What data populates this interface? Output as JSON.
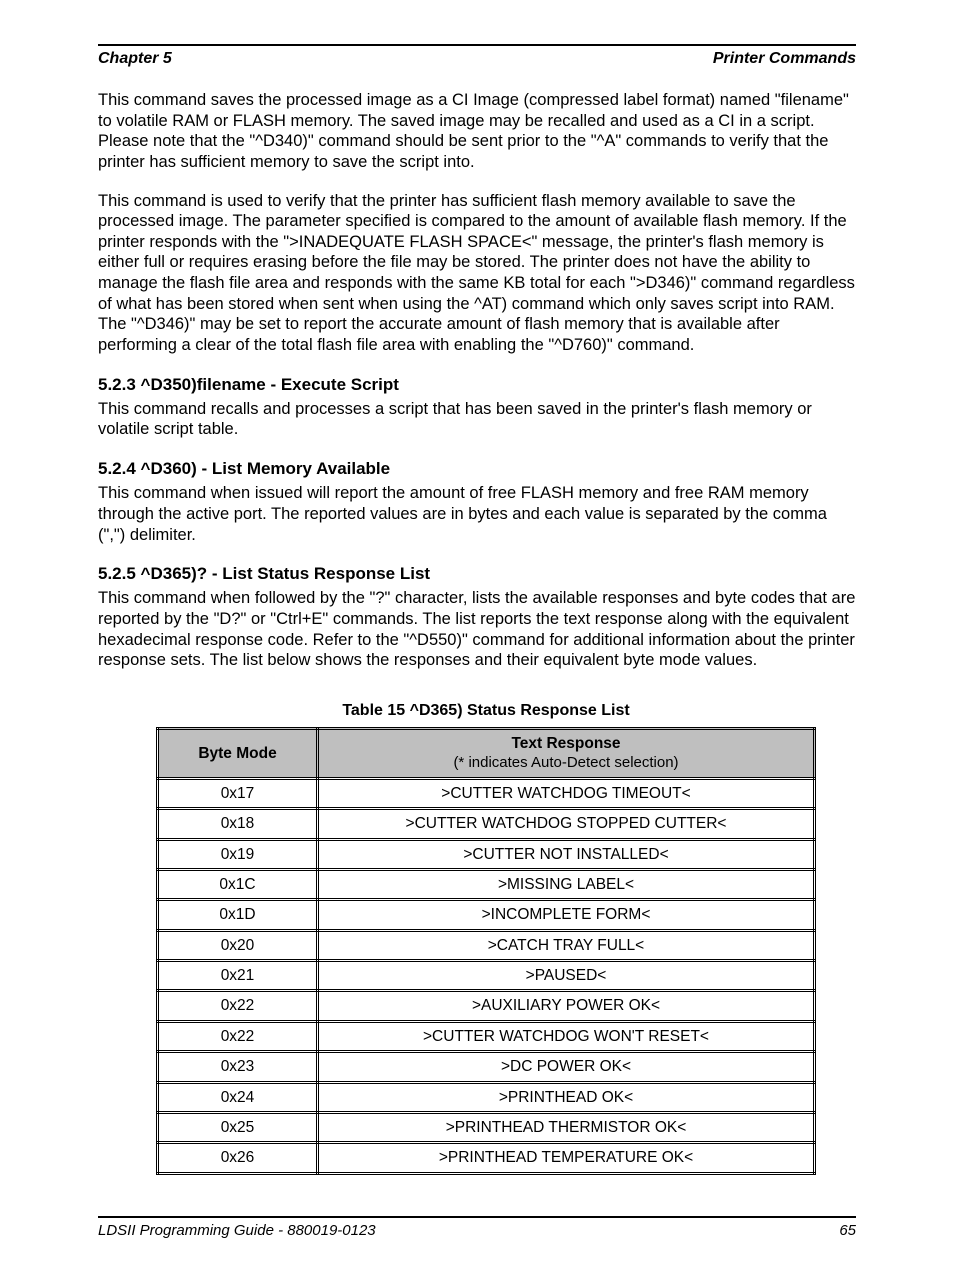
{
  "header": {
    "left": "Chapter 5",
    "right": "Printer Commands"
  },
  "paragraphs": {
    "p1": "This command saves the processed image as a CI Image (compressed label format) named \"filename\" to volatile RAM or FLASH memory. The saved image may be recalled and used as a CI in a script. Please note that the \"^D340)\" command should be sent prior to the \"^A\" commands to verify that the printer has sufficient memory to save the script into.",
    "p2": "This command is used to verify that the printer has sufficient flash memory available to save the processed image. The parameter specified is compared to the amount of available flash memory. If the printer responds with the \">INADEQUATE FLASH SPACE<\" message, the printer's flash memory is either full or requires erasing before the file may be stored. The printer does not have the ability to manage the flash file area and responds with the same KB total for each \">D346)\" command regardless of what has been stored when sent when using the ^AT) command which only saves script into RAM. The \"^D346)\" may be set to report the accurate amount of flash memory that is available after performing a clear of the total flash file area with enabling the \"^D760)\" command.",
    "p3_title": "5.2.3  ^D350)filename  - Execute Script",
    "p3": "This command recalls and processes a script that has been saved in the printer's flash memory or volatile script table.",
    "p4_title": "5.2.4  ^D360)  - List Memory Available",
    "p4": "This command when issued will report the amount of free FLASH memory and free RAM memory through the active port. The reported values are in bytes and each value is separated by the comma (\",\") delimiter.",
    "p5_title": "5.2.5  ^D365)?  - List Status Response List",
    "p5": "This command when followed by the \"?\" character, lists the available responses and byte codes that are reported by the \"D?\" or \"Ctrl+E\" commands. The list reports the text response along with the equivalent hexadecimal response code. Refer to the \"^D550)\" command for additional information about the printer response sets. The list below shows the responses and their equivalent byte mode values.",
    "table_caption": "Table 15   ^D365) Status Response List"
  },
  "table": {
    "head1": "Byte Mode",
    "head2_line1": "Text Response",
    "head2_line2": "(* indicates Auto-Detect selection)",
    "rows": [
      [
        "0x17",
        ">CUTTER WATCHDOG TIMEOUT<"
      ],
      [
        "0x18",
        ">CUTTER WATCHDOG STOPPED CUTTER<"
      ],
      [
        "0x19",
        ">CUTTER NOT INSTALLED<"
      ],
      [
        "0x1C",
        ">MISSING LABEL<"
      ],
      [
        "0x1D",
        ">INCOMPLETE FORM<"
      ],
      [
        "0x20",
        ">CATCH TRAY FULL<"
      ],
      [
        "0x21",
        ">PAUSED<"
      ],
      [
        "0x22",
        ">AUXILIARY POWER OK<"
      ],
      [
        "0x22",
        ">CUTTER WATCHDOG WON'T RESET<"
      ],
      [
        "0x23",
        ">DC POWER OK<"
      ],
      [
        "0x24",
        ">PRINTHEAD OK<"
      ],
      [
        "0x25",
        ">PRINTHEAD THERMISTOR OK<"
      ],
      [
        "0x26",
        ">PRINTHEAD TEMPERATURE OK<"
      ]
    ]
  },
  "footer": {
    "left": "LDSII Programming Guide - 880019-0123",
    "right": "65"
  }
}
